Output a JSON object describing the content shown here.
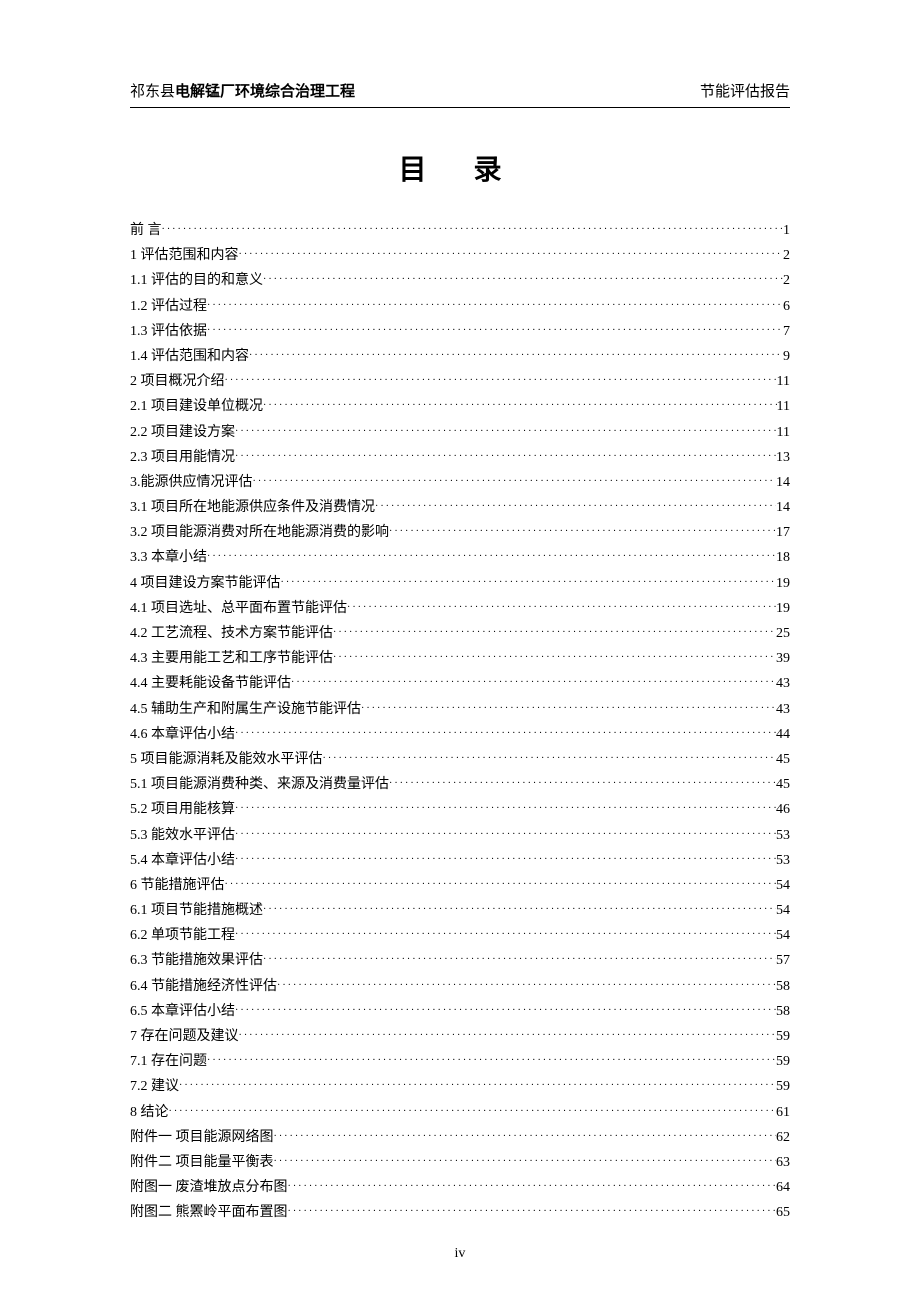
{
  "header": {
    "left_prefix": "祁东县",
    "left_bold": "电解锰厂环境综合治理工程",
    "right": "节能评估报告"
  },
  "toc_title": "目 录",
  "toc": [
    {
      "label": "前  言",
      "page": "1"
    },
    {
      "label": "1 评估范围和内容",
      "page": "2"
    },
    {
      "label": "1.1 评估的目的和意义",
      "page": "2"
    },
    {
      "label": "1.2 评估过程",
      "page": "6"
    },
    {
      "label": "1.3 评估依据",
      "page": "7"
    },
    {
      "label": "1.4 评估范围和内容",
      "page": "9"
    },
    {
      "label": "2 项目概况介绍",
      "page": "11"
    },
    {
      "label": "2.1 项目建设单位概况",
      "page": "11"
    },
    {
      "label": "2.2 项目建设方案",
      "page": "11"
    },
    {
      "label": "2.3 项目用能情况",
      "page": "13"
    },
    {
      "label": "3.能源供应情况评估",
      "page": "14"
    },
    {
      "label": "3.1 项目所在地能源供应条件及消费情况",
      "page": "14"
    },
    {
      "label": "3.2 项目能源消费对所在地能源消费的影响",
      "page": "17"
    },
    {
      "label": "3.3 本章小结",
      "page": "18"
    },
    {
      "label": "4 项目建设方案节能评估",
      "page": "19"
    },
    {
      "label": "4.1 项目选址、总平面布置节能评估",
      "page": "19"
    },
    {
      "label": "4.2 工艺流程、技术方案节能评估",
      "page": "25"
    },
    {
      "label": "4.3 主要用能工艺和工序节能评估",
      "page": "39"
    },
    {
      "label": "4.4 主要耗能设备节能评估",
      "page": "43"
    },
    {
      "label": "4.5 辅助生产和附属生产设施节能评估",
      "page": "43"
    },
    {
      "label": "4.6 本章评估小结",
      "page": "44"
    },
    {
      "label": "5 项目能源消耗及能效水平评估",
      "page": "45"
    },
    {
      "label": "5.1 项目能源消费种类、来源及消费量评估",
      "page": "45"
    },
    {
      "label": "5.2 项目用能核算",
      "page": "46"
    },
    {
      "label": "5.3 能效水平评估",
      "page": "53"
    },
    {
      "label": "5.4 本章评估小结",
      "page": "53"
    },
    {
      "label": "6 节能措施评估",
      "page": "54"
    },
    {
      "label": "6.1 项目节能措施概述",
      "page": "54"
    },
    {
      "label": "6.2 单项节能工程",
      "page": "54"
    },
    {
      "label": "6.3 节能措施效果评估",
      "page": "57"
    },
    {
      "label": "6.4 节能措施经济性评估",
      "page": "58"
    },
    {
      "label": "6.5 本章评估小结",
      "page": "58"
    },
    {
      "label": "7 存在问题及建议",
      "page": "59"
    },
    {
      "label": "7.1 存在问题",
      "page": "59"
    },
    {
      "label": "7.2 建议",
      "page": "59"
    },
    {
      "label": "8 结论",
      "page": "61"
    },
    {
      "label": "附件一 项目能源网络图",
      "page": "62"
    },
    {
      "label": "附件二 项目能量平衡表",
      "page": "63"
    },
    {
      "label": "附图一  废渣堆放点分布图",
      "page": "64"
    },
    {
      "label": "附图二  熊罴岭平面布置图",
      "page": "65"
    }
  ],
  "page_number": "iv"
}
